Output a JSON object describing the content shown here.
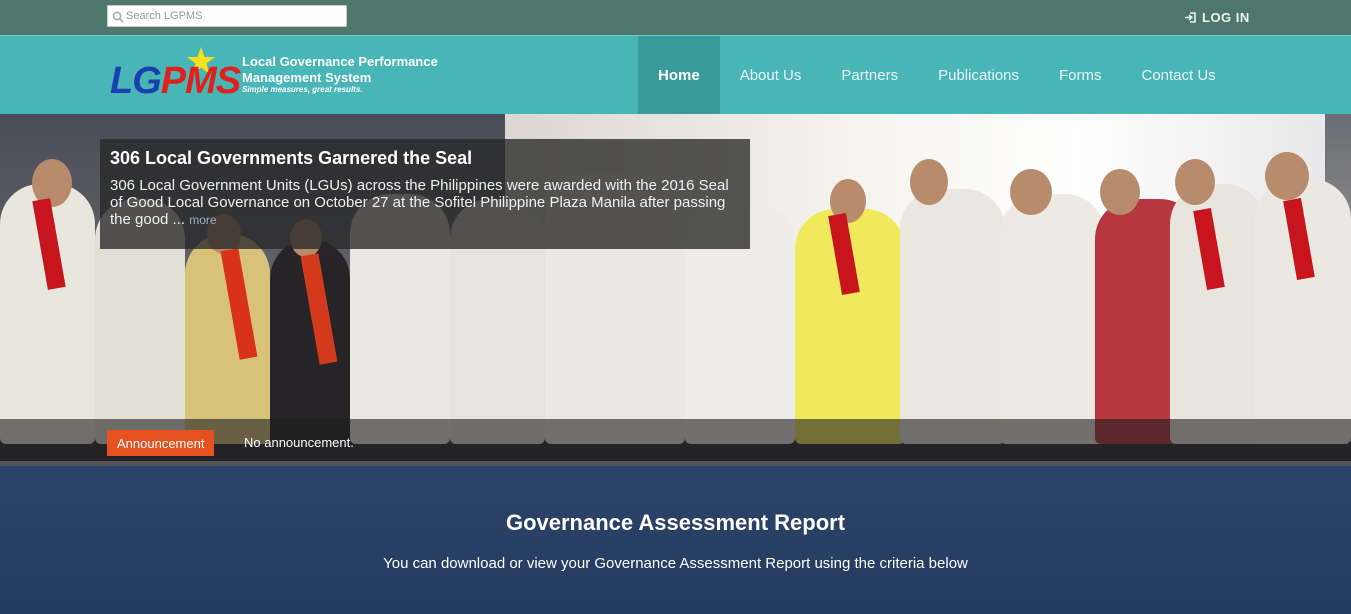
{
  "topbar": {
    "search_placeholder": "Search LGPMS",
    "login_label": "LOG IN"
  },
  "logo": {
    "letters_lg": "LG",
    "letters_pms": "PMS",
    "line1": "Local Governance Performance",
    "line2": "Management System",
    "tagline": "Simple measures, great results."
  },
  "nav": {
    "items": [
      {
        "label": "Home"
      },
      {
        "label": "About Us"
      },
      {
        "label": "Partners"
      },
      {
        "label": "Publications"
      },
      {
        "label": "Forms"
      },
      {
        "label": "Contact Us"
      }
    ]
  },
  "hero": {
    "title": "306 Local Governments Garnered the Seal",
    "body": "306 Local Government Units (LGUs) across the Philippines were awarded with the 2016 Seal of Good Local Governance on October 27 at the Sofitel Philippine Plaza Manila after passing the good ... ",
    "more_label": "more"
  },
  "announcement": {
    "button_label": "Announcement",
    "text": "No announcement."
  },
  "report": {
    "title": "Governance Assessment Report",
    "subtitle": "You can download or view your Governance Assessment Report using the criteria below"
  },
  "colors": {
    "topbar": "#4d776b",
    "navbar": "#48b5b6",
    "nav_active": "#3a9a9a",
    "announce_button": "#e5521f",
    "report_bg": "#243a5e"
  }
}
